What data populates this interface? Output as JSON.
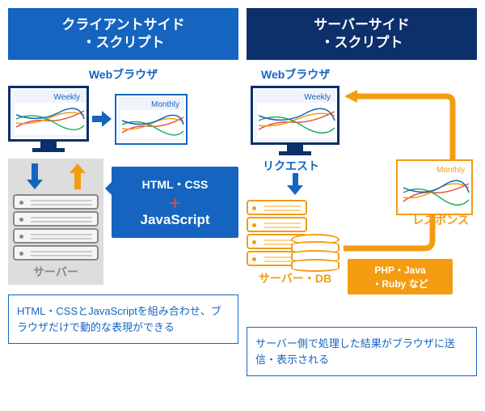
{
  "left": {
    "title": "クライアントサイド\n・スクリプト",
    "browser_label": "Webブラウザ",
    "chart1_title": "Weekly",
    "chart2_title": "Monthly",
    "server_label": "サーバー",
    "callout_line1": "HTML・CSS",
    "callout_plus": "＋",
    "callout_line2": "JavaScript",
    "footer": "HTML・CSSとJavaScriptを組み合わせ、ブラウザだけで動的な表現ができる"
  },
  "right": {
    "title": "サーバーサイド\n・スクリプト",
    "browser_label": "Webブラウザ",
    "chart1_title": "Weekly",
    "chart2_title": "Monthly",
    "request_label": "リクエスト",
    "response_label": "レスポンス",
    "server_label": "サーバー・DB",
    "lang_callout": "PHP・Java\n・Ruby など",
    "footer": "サーバー側で処理した結果がブラウザに送信・表示される"
  },
  "colors": {
    "blue": "#1565c0",
    "navy": "#0d2f6b",
    "orange": "#f39c12",
    "gray": "#888",
    "red": "#e74c3c"
  }
}
